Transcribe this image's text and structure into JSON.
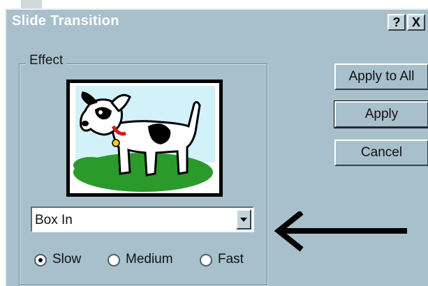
{
  "window": {
    "title": "Slide Transition"
  },
  "titlebar_buttons": {
    "help": "?",
    "close": "X"
  },
  "effect_group": {
    "label": "Effect"
  },
  "preview": {
    "alt": "dog picture preview"
  },
  "effect_select": {
    "value": "Box In"
  },
  "speed": {
    "options": [
      {
        "label": "Slow",
        "checked": true
      },
      {
        "label": "Medium",
        "checked": false
      },
      {
        "label": "Fast",
        "checked": false
      }
    ]
  },
  "buttons": {
    "apply_to_all": "Apply to All",
    "apply": "Apply",
    "cancel": "Cancel"
  },
  "colors": {
    "dialog_bg": "#a8c0cc",
    "title_text": "#ffffff",
    "grass": "#2a9a2a",
    "sky": "#c8eef8"
  }
}
